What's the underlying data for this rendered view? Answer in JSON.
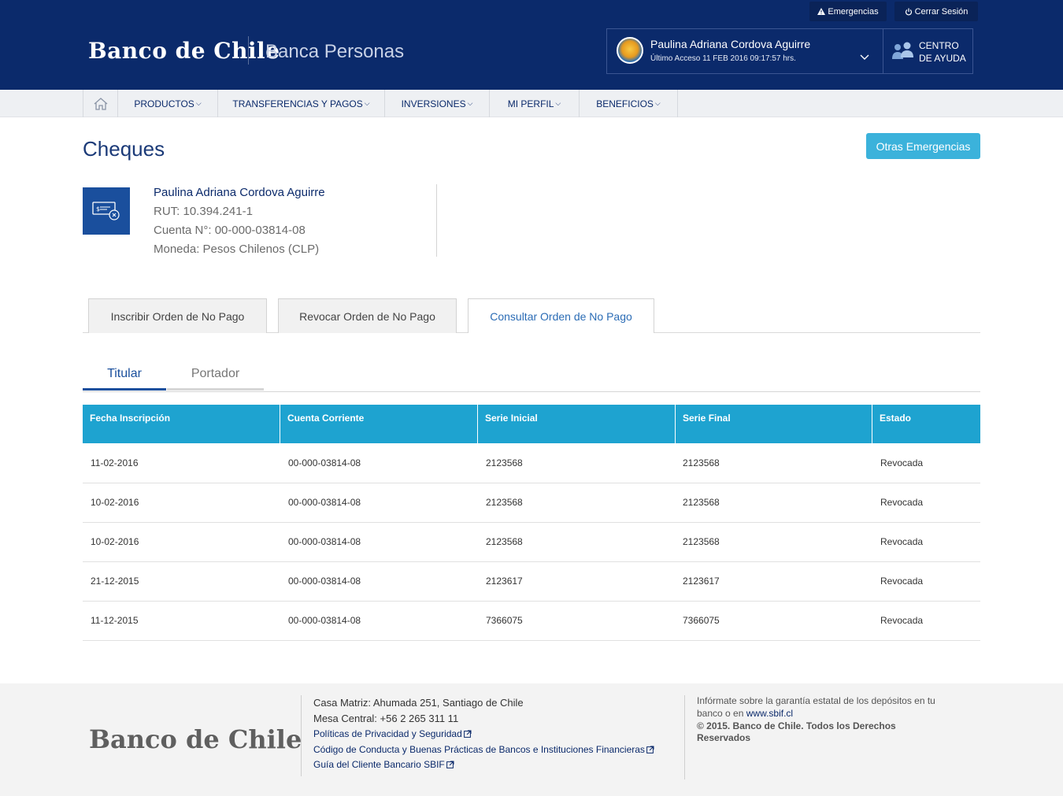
{
  "header": {
    "logo": "Banco de Chile",
    "section": "Banca Personas",
    "utility": {
      "emergencias": "Emergencias",
      "cerrar_sesion": "Cerrar Sesión"
    },
    "user": {
      "name": "Paulina Adriana Cordova Aguirre",
      "last_access": "Último Acceso 11 FEB 2016 09:17:57 hrs."
    },
    "help": {
      "line1": "CENTRO",
      "line2": "DE AYUDA"
    }
  },
  "nav": {
    "items": [
      {
        "label": "PRODUCTOS"
      },
      {
        "label": "TRANSFERENCIAS Y PAGOS"
      },
      {
        "label": "INVERSIONES"
      },
      {
        "label": "MI PERFIL"
      },
      {
        "label": "BENEFICIOS"
      }
    ]
  },
  "page": {
    "title": "Cheques",
    "action_button": "Otras Emergencias"
  },
  "account": {
    "name": "Paulina Adriana Cordova Aguirre",
    "rut": "RUT: 10.394.241-1",
    "cuenta": "Cuenta N°: 00-000-03814-08",
    "moneda": "Moneda: Pesos Chilenos (CLP)"
  },
  "tabs": [
    {
      "label": "Inscribir Orden de No Pago"
    },
    {
      "label": "Revocar Orden de No Pago"
    },
    {
      "label": "Consultar Orden de No Pago"
    }
  ],
  "subtabs": {
    "titular": "Titular",
    "portador": "Portador"
  },
  "table": {
    "headers": [
      "Fecha Inscripción",
      "Cuenta Corriente",
      "Serie Inicial",
      "Serie Final",
      "Estado"
    ],
    "rows": [
      [
        "11-02-2016",
        "00-000-03814-08",
        "2123568",
        "2123568",
        "Revocada"
      ],
      [
        "10-02-2016",
        "00-000-03814-08",
        "2123568",
        "2123568",
        "Revocada"
      ],
      [
        "10-02-2016",
        "00-000-03814-08",
        "2123568",
        "2123568",
        "Revocada"
      ],
      [
        "21-12-2015",
        "00-000-03814-08",
        "2123617",
        "2123617",
        "Revocada"
      ],
      [
        "11-12-2015",
        "00-000-03814-08",
        "7366075",
        "7366075",
        "Revocada"
      ]
    ]
  },
  "footer": {
    "logo": "Banco de Chile",
    "address": "Casa Matriz: Ahumada 251, Santiago de Chile",
    "phone": "Mesa Central: +56 2 265 311 11",
    "links": [
      "Políticas de Privacidad y Seguridad",
      "Código de Conducta y Buenas Prácticas de Bancos e Instituciones Financieras",
      "Guía del Cliente Bancario SBIF"
    ],
    "guarantee_1": "Infórmate sobre la garantía estatal de los depósitos en tu",
    "guarantee_2": "banco o en",
    "guarantee_link": "www.sbif.cl",
    "copyright_1": "© 2015. Banco de Chile. Todos los Derechos",
    "copyright_2": "Reservados"
  },
  "colors": {
    "brand_navy": "#0b2a6b",
    "accent_cyan": "#1ea3d0",
    "button_cyan": "#3bb2db"
  }
}
